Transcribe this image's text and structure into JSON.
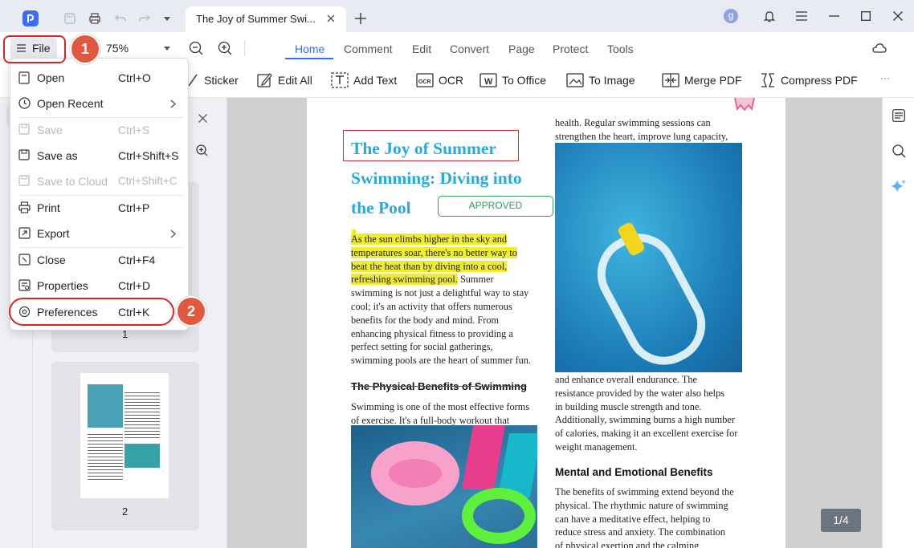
{
  "window": {
    "tab_title": "The Joy of Summer Swi...",
    "user_initial": "g"
  },
  "toolbar": {
    "file_label": "File",
    "zoom": "75%",
    "tabs": [
      "Home",
      "Comment",
      "Edit",
      "Convert",
      "Page",
      "Protect",
      "Tools"
    ],
    "tools": [
      "Sticker",
      "Edit All",
      "Add Text",
      "OCR",
      "To Office",
      "To Image",
      "Merge PDF",
      "Compress PDF"
    ],
    "more": "···"
  },
  "file_menu": {
    "items": [
      {
        "label": "Open",
        "shortcut": "Ctrl+O"
      },
      {
        "label": "Open Recent",
        "shortcut": ""
      },
      {
        "label": "Save",
        "shortcut": "Ctrl+S"
      },
      {
        "label": "Save as",
        "shortcut": "Ctrl+Shift+S"
      },
      {
        "label": "Save to Cloud",
        "shortcut": "Ctrl+Shift+C"
      },
      {
        "label": "Print",
        "shortcut": "Ctrl+P"
      },
      {
        "label": "Export",
        "shortcut": ""
      },
      {
        "label": "Close",
        "shortcut": "Ctrl+F4"
      },
      {
        "label": "Properties",
        "shortcut": "Ctrl+D"
      },
      {
        "label": "Preferences",
        "shortcut": "Ctrl+K"
      }
    ]
  },
  "steps": [
    "1",
    "2"
  ],
  "thumbnails": {
    "page1_label": "1",
    "page2_label": "2"
  },
  "document": {
    "title_lines": [
      "The Joy of Summer",
      "Swimming: Diving into",
      "the Pool"
    ],
    "stamp": "APPROVED",
    "intro_highlighted": [
      "As the sun climbs higher in the sky and",
      "temperatures soar, there's no better way to",
      "beat the heat than by diving into a cool,",
      "refreshing swimming pool."
    ],
    "intro_rest_first": "Summer",
    "intro_lines": [
      "swimming is not just a delightful way to stay",
      "cool; it's an activity that offers numerous",
      "benefits for the body and mind. From",
      "enhancing physical fitness to providing a",
      "perfect setting for social gatherings,",
      "swimming pools are the heart of summer fun."
    ],
    "heading1": "The Physical Benefits of Swimming",
    "para2_lines": [
      "Swimming is one of the most effective forms",
      "of exercise. It's a full-body workout that"
    ],
    "col2_top_lines": [
      "health. Regular swimming sessions can",
      "strengthen the heart, improve lung capacity,"
    ],
    "col2_mid_lines": [
      "and enhance overall endurance. The",
      "resistance provided by the water also helps",
      "in building muscle strength and tone.",
      "Additionally, swimming burns a high number",
      "of calories, making it an excellent exercise for",
      "weight management."
    ],
    "heading2": "Mental and Emotional Benefits",
    "col2_bottom_lines": [
      "The benefits of swimming extend beyond the",
      "physical. The rhythmic nature of swimming",
      "can have a meditative effect, helping to",
      "reduce stress and anxiety. The combination",
      "of physical exertion and the calming"
    ]
  },
  "page_indicator": "1/4",
  "colors": {
    "accent": "#2f6ef0",
    "title_blue": "#29a9e0",
    "badge": "#e0593f",
    "highlight": "#f2ec2e",
    "stamp_green": "#2e9e5b"
  }
}
